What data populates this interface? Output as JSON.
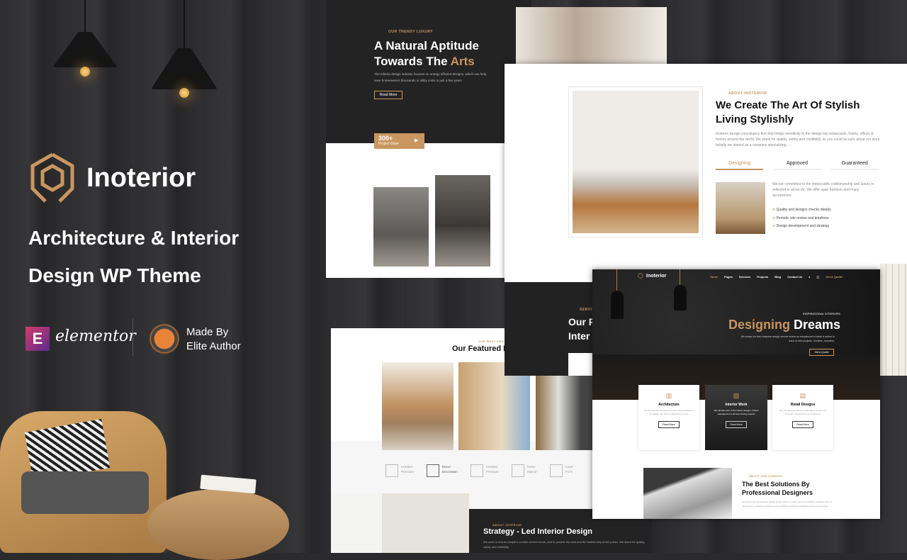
{
  "brand": {
    "name": "Inoterior",
    "tagline_line1": "Architecture & Interior",
    "tagline_line2": "Design WP Theme",
    "accent": "#c9965f"
  },
  "badges": {
    "elementor": "elementor",
    "elementor_icon": "E",
    "made_by_line1": "Made By",
    "made_by_line2": "Elite Author"
  },
  "hero1": {
    "eyebrow": "OUR TRENDY LUXURY",
    "title_line1": "A Natural Aptitude",
    "title_line2_a": "Towards The ",
    "title_line2_b": "Arts",
    "paragraph": "The Inferior design industry focuses on energy efficient designs, which can help save homeowners thousands in utility costs in just a few years.",
    "button": "Read More",
    "counter": "300+",
    "counter_label": "Project Done"
  },
  "about": {
    "eyebrow": "ABOUT INOTERIOR",
    "title_line1": "We Create The Art Of Stylish",
    "title_line2": "Living Stylishly",
    "paragraph": "Inoterior design consultancy firm that brings sensitivity to the design top restaurants, hotels, offices & homes around the world. We stand for quality, safety and credibility, so you could be sure about our work. Initially we started as a company specializing",
    "tabs": [
      "Designing",
      "Approved",
      "Guaranteed"
    ],
    "tab_text": "We are committed to the impeccable craftsmanship and luxury is reflected in all we do. We offer span furniture and many accessories.",
    "checks": [
      "Quality and designs checks deeply",
      "Periodic site review and timelines",
      "Design development and strategy"
    ]
  },
  "services": {
    "eyebrow": "SERVIC",
    "title_line1": "Our F",
    "title_line2": "Inter"
  },
  "featured": {
    "eyebrow": "OUR BEST PROJECTS",
    "title": "Our Featured P",
    "partners": [
      {
        "l1": "Creative",
        "l2": "Premium"
      },
      {
        "l1": "Decor",
        "l2": "Decoration"
      },
      {
        "l1": "Creative",
        "l2": "Premium"
      },
      {
        "l1": "Home",
        "l2": "Interior"
      },
      {
        "l1": "Komf",
        "l2": "Furni"
      }
    ]
  },
  "strategy": {
    "eyebrow": "ABOUT INTERIOR",
    "title": "Strategy - Led Interior Design",
    "paragraph": "We work to ensure people's comfort at their home, and to provide the best and the fastest help at fair prices. We stand for quality, safety and credibility"
  },
  "home": {
    "logo": "Inoterior",
    "nav": [
      "Home",
      "Pages",
      "Services",
      "Projects",
      "Blog",
      "Contact Us"
    ],
    "cta": "Get A Quote!",
    "eyebrow": "INSPIRATIONAL INTERIORS",
    "title_a": "Designing",
    "title_b": " Dreams",
    "paragraph": "We known for their bespoke design service where an educational of detail is added to each of their projects. Creative, receptive.",
    "button": "Get A Quote!",
    "cards": [
      {
        "title": "Architecture",
        "text": "We develop the full cycle of project documentation & full details. Our clients satisfaction is more",
        "button": "Read More"
      },
      {
        "title": "Interior Work",
        "text": "We will take care of the interior designs, build & management of all kind of living projects",
        "button": "Read More"
      },
      {
        "title": "Retail Designs",
        "text": "We can help you with the retail interior design and third party management to create best",
        "button": "Read More"
      }
    ],
    "about_eyebrow": "ABOUT OUR COMPANY",
    "about_title_line1": "The Best Solutions By",
    "about_title_line2": "Professional Designers",
    "about_text": "We known for their bespoke design service where a recent element of detail is added to each of their projects. Creative, receptive and not afraid to push the boundaries of the best possible."
  }
}
